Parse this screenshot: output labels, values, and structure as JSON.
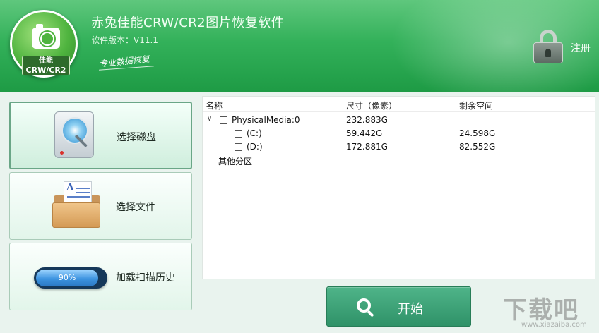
{
  "header": {
    "title": "赤兔佳能CRW/CR2图片恢复软件",
    "version": "软件版本：V11.1",
    "slogan": "专业数据恢复",
    "register_label": "注册",
    "logo_line1": "佳能",
    "logo_line2": "CRW/CR2",
    "icons": {
      "logo": "camera-logo-icon",
      "lock": "lock-icon"
    }
  },
  "sidebar": {
    "items": [
      {
        "label": "选择磁盘",
        "icon": "hard-disk-icon",
        "active": true
      },
      {
        "label": "选择文件",
        "icon": "folder-document-icon",
        "active": false
      },
      {
        "label": "加载扫描历史",
        "icon": "progress-icon",
        "progress": "90%",
        "active": false
      }
    ]
  },
  "table": {
    "columns": [
      "名称",
      "尺寸（像素）",
      "剩余空间"
    ],
    "rows": [
      {
        "name": "PhysicalMedia:0",
        "size": "232.883G",
        "free": "",
        "level": 0
      },
      {
        "name": "(C:)",
        "size": "59.442G",
        "free": "24.598G",
        "level": 1
      },
      {
        "name": "(D:)",
        "size": "172.881G",
        "free": "82.552G",
        "level": 1
      },
      {
        "name": "其他分区",
        "size": "",
        "free": "",
        "level": 0
      }
    ]
  },
  "start": {
    "label": "开始",
    "icon": "search-icon"
  },
  "watermark": {
    "main": "下载吧",
    "sub": "www.xiazaiba.com"
  },
  "colors": {
    "header_green": "#33b15a",
    "start_green": "#3fa478",
    "panel_bg": "#e9f3ee"
  }
}
